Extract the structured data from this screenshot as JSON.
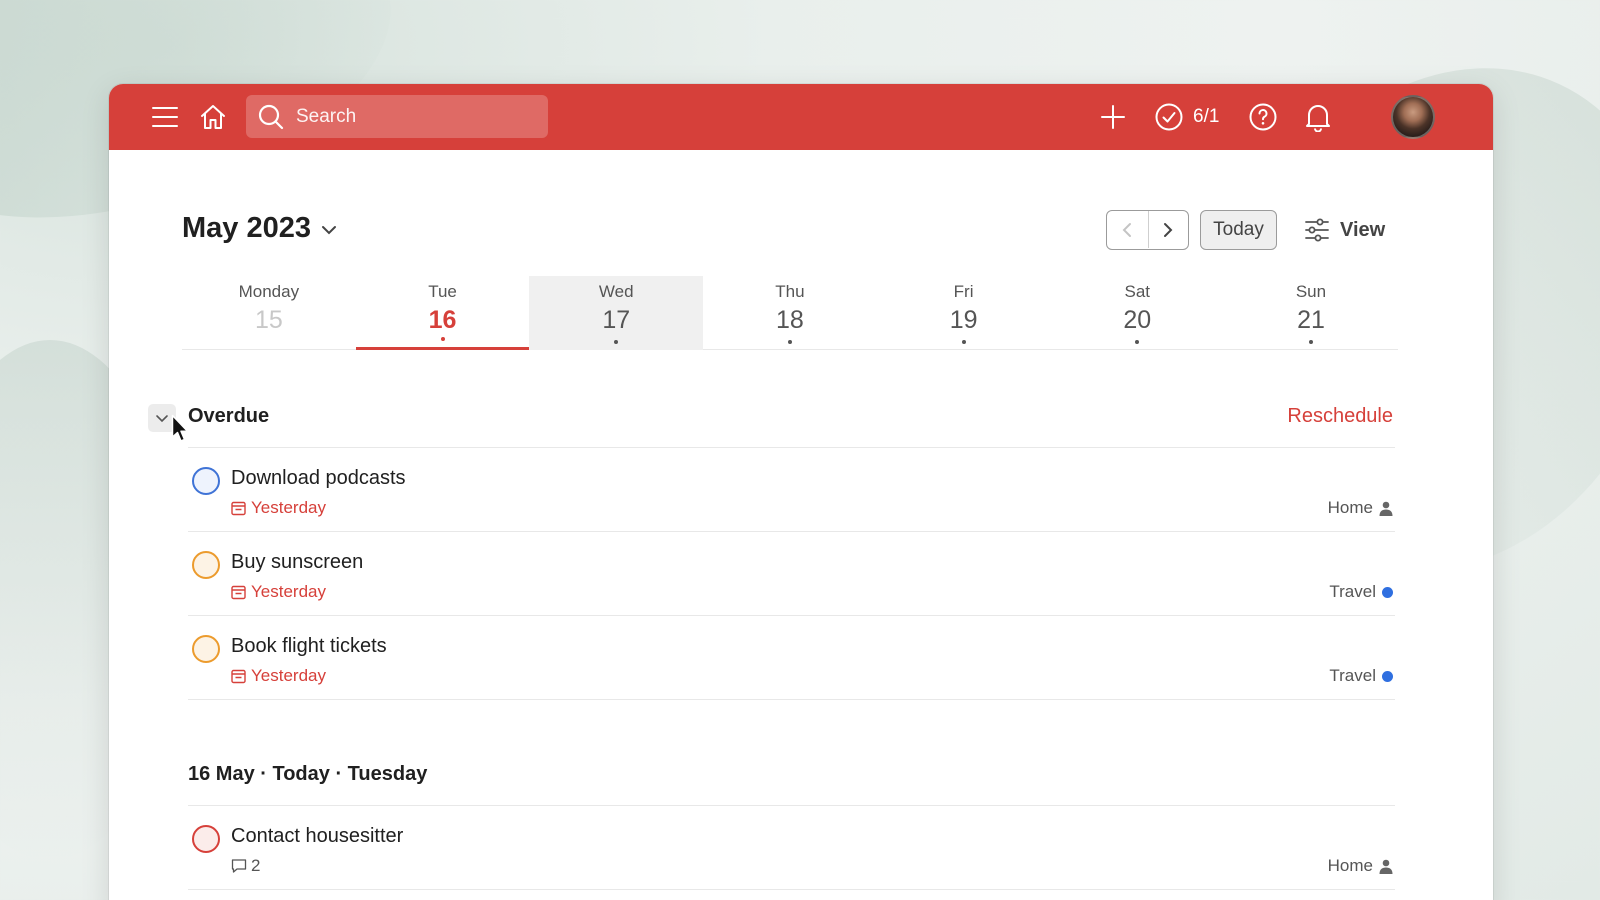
{
  "topbar": {
    "search_placeholder": "Search",
    "karma": "6/1"
  },
  "header": {
    "month": "May 2023",
    "today_label": "Today",
    "view_label": "View"
  },
  "week": [
    {
      "name": "Monday",
      "num": "15"
    },
    {
      "name": "Tue",
      "num": "16"
    },
    {
      "name": "Wed",
      "num": "17"
    },
    {
      "name": "Thu",
      "num": "18"
    },
    {
      "name": "Fri",
      "num": "19"
    },
    {
      "name": "Sat",
      "num": "20"
    },
    {
      "name": "Sun",
      "num": "21"
    }
  ],
  "overdue": {
    "title": "Overdue",
    "action": "Reschedule",
    "tasks": [
      {
        "title": "Download podcasts",
        "due": "Yesterday",
        "project": "Home",
        "color": "#3f73d6"
      },
      {
        "title": "Buy sunscreen",
        "due": "Yesterday",
        "project": "Travel",
        "color": "#ec9b2d"
      },
      {
        "title": "Book flight tickets",
        "due": "Yesterday",
        "project": "Travel",
        "color": "#ec9b2d"
      }
    ]
  },
  "today": {
    "title": "16 May · Today · Tuesday",
    "tasks": [
      {
        "title": "Contact housesitter",
        "comments": "2",
        "project": "Home",
        "color": "#d6403a"
      }
    ]
  },
  "colors": {
    "brand": "#d6403a",
    "travel_dot": "#2f6fe0"
  }
}
